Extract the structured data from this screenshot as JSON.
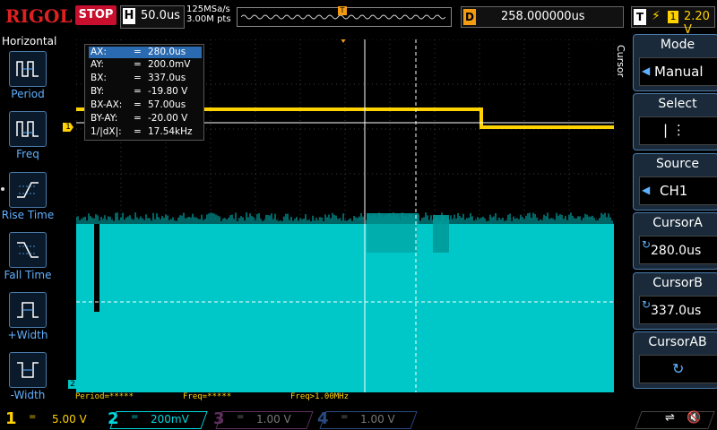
{
  "top": {
    "brand": "RIGOL",
    "run_state": "STOP",
    "timebase_label": "H",
    "timebase": "50.0us",
    "sample_rate": "125MSa/s",
    "memory_depth": "3.00M pts",
    "delay_label": "D",
    "delay": "258.000000us",
    "trigger_label": "T",
    "trigger_source": "1",
    "trigger_level": "2.20 V",
    "trigger_marker": "T"
  },
  "left_menu": {
    "title": "Horizontal",
    "items": [
      {
        "label": "Period",
        "icon": "period-icon"
      },
      {
        "label": "Freq",
        "icon": "freq-icon"
      },
      {
        "label": "Rise Time",
        "icon": "rise-time-icon"
      },
      {
        "label": "Fall Time",
        "icon": "fall-time-icon"
      },
      {
        "label": "+Width",
        "icon": "pos-width-icon"
      },
      {
        "label": "-Width",
        "icon": "neg-width-icon"
      }
    ]
  },
  "cursor_table": {
    "rows": [
      {
        "key": "AX:",
        "eq": "=",
        "value": "280.0us"
      },
      {
        "key": "AY:",
        "eq": "=",
        "value": "200.0mV"
      },
      {
        "key": "BX:",
        "eq": "=",
        "value": "337.0us"
      },
      {
        "key": "BY:",
        "eq": "=",
        "value": "-19.80 V"
      },
      {
        "key": "BX-AX:",
        "eq": "=",
        "value": "57.00us"
      },
      {
        "key": "BY-AY:",
        "eq": "=",
        "value": "-20.00 V"
      },
      {
        "key": "1/|dX|:",
        "eq": "=",
        "value": "17.54kHz"
      }
    ]
  },
  "status_line": {
    "period": "Period=*****",
    "freq": "Freq=*****",
    "freq_gt": "Freq>1.00MHz"
  },
  "markers": {
    "ch1": "1",
    "ch2": "2",
    "trig_level": "T"
  },
  "right_menu": {
    "vertical_label": "Cursor",
    "mode_head": "Mode",
    "mode_value": "Manual",
    "select_head": "Select",
    "select_value": "| ⋮",
    "source_head": "Source",
    "source_value": "CH1",
    "cursor_a_head": "CursorA",
    "cursor_a_value": "280.0us",
    "cursor_b_head": "CursorB",
    "cursor_b_value": "337.0us",
    "cursor_ab_head": "CursorAB"
  },
  "channels": [
    {
      "num": "1",
      "coupling": "=",
      "scale": "5.00 V",
      "color": "#ffd200",
      "active": true
    },
    {
      "num": "2",
      "coupling": "=",
      "scale": "200mV",
      "color": "#00d8e0",
      "active": true
    },
    {
      "num": "3",
      "coupling": "=",
      "scale": "1.00 V",
      "color": "#c040c0",
      "active": false
    },
    {
      "num": "4",
      "coupling": "=",
      "scale": "1.00 V",
      "color": "#2f6fd8",
      "active": false
    }
  ],
  "colors": {
    "ch1": "#ffd200",
    "ch2": "#00c8c8",
    "accent": "#4a7aa8",
    "stop": "#c8102e",
    "trigger": "#f39c12"
  }
}
